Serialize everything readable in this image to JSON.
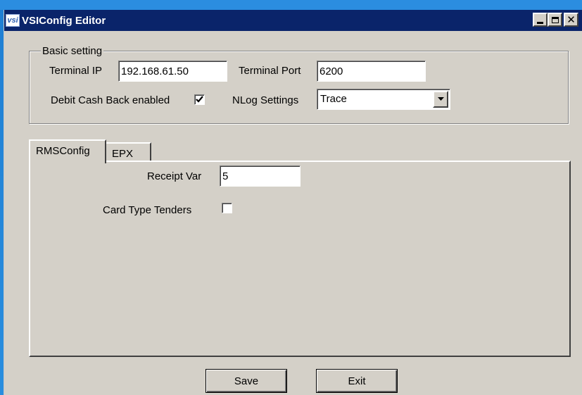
{
  "window": {
    "title": "VSIConfig Editor",
    "icon_text": "vsi"
  },
  "basic": {
    "legend": "Basic setting",
    "terminal_ip_label": "Terminal IP",
    "terminal_ip_value": "192.168.61.50",
    "terminal_port_label": "Terminal Port",
    "terminal_port_value": "6200",
    "debit_cashback_label": "Debit Cash Back enabled",
    "debit_cashback_checked": true,
    "nlog_label": "NLog Settings",
    "nlog_value": "Trace"
  },
  "tabs": [
    {
      "label": "RMSConfig",
      "active": true
    },
    {
      "label": "EPX",
      "active": false
    }
  ],
  "rms": {
    "receipt_var_label": "Receipt Var",
    "receipt_var_value": "5",
    "card_type_label": "Card Type Tenders",
    "card_type_checked": false
  },
  "buttons": {
    "save": "Save",
    "exit": "Exit"
  }
}
